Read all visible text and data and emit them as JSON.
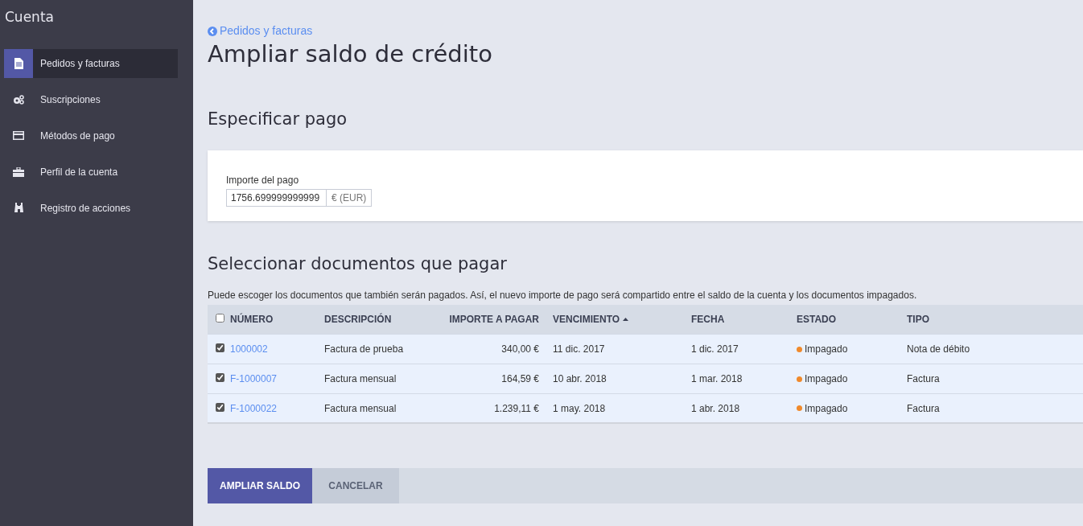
{
  "sidebar": {
    "title": "Cuenta",
    "items": [
      {
        "label": "Pedidos y facturas",
        "selected": true
      },
      {
        "label": "Suscripciones",
        "selected": false
      },
      {
        "label": "Métodos de pago",
        "selected": false
      },
      {
        "label": "Perfil de la cuenta",
        "selected": false
      },
      {
        "label": "Registro de acciones",
        "selected": false
      }
    ]
  },
  "back_link": "Pedidos y facturas",
  "title": "Ampliar saldo de crédito",
  "payment": {
    "heading": "Especificar pago",
    "label": "Importe del pago",
    "value": "1756.699999999999",
    "currency": "€ (EUR)"
  },
  "documents": {
    "heading": "Seleccionar documentos que pagar",
    "description": "Puede escoger los documentos que también serán pagados. Así, el nuevo importe de pago será compartido entre el saldo de la cuenta y los documentos impagados.",
    "select_all": {
      "checked": false
    },
    "columns": [
      {
        "label": "NÚMERO",
        "sorted": false
      },
      {
        "label": "DESCRIPCIÓN",
        "sorted": false
      },
      {
        "label": "IMPORTE A PAGAR",
        "sorted": false
      },
      {
        "label": "VENCIMIENTO",
        "sorted": true
      },
      {
        "label": "FECHA",
        "sorted": false
      },
      {
        "label": "ESTADO",
        "sorted": false
      },
      {
        "label": "TIPO",
        "sorted": false
      }
    ],
    "rows": [
      {
        "checked": true,
        "number": "1000002",
        "description": "Factura de prueba",
        "amount": "340,00 €",
        "due": "11 dic. 2017",
        "date": "1 dic. 2017",
        "status": "Impagado",
        "color": "#f0892b",
        "type": "Nota de débito"
      },
      {
        "checked": true,
        "number": "F-1000007",
        "description": "Factura mensual",
        "amount": "164,59 €",
        "due": "10 abr. 2018",
        "date": "1 mar. 2018",
        "status": "Impagado",
        "color": "#f0892b",
        "type": "Factura"
      },
      {
        "checked": true,
        "number": "F-1000022",
        "description": "Factura mensual",
        "amount": "1.239,11 €",
        "due": "1 may. 2018",
        "date": "1 abr. 2018",
        "status": "Impagado",
        "color": "#f0892b",
        "type": "Factura"
      }
    ]
  },
  "buttons": [
    "AMPLIAR SALDO",
    "CANCELAR"
  ]
}
